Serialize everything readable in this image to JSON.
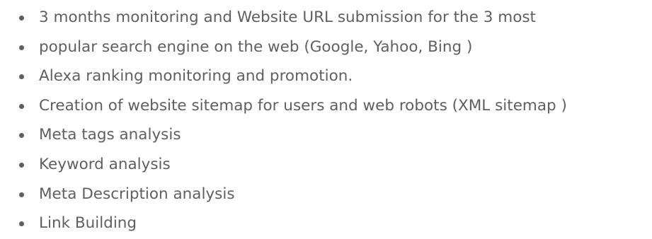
{
  "list": {
    "items": [
      "3 months monitoring and Website URL submission for the 3 most",
      "popular search engine on the web (Google, Yahoo, Bing )",
      "Alexa ranking monitoring and promotion.",
      "Creation of website sitemap for users and web robots (XML sitemap )",
      "Meta tags analysis",
      "Keyword analysis",
      "Meta Description analysis",
      "Link Building"
    ]
  },
  "colors": {
    "text": "#5f5f5f",
    "background": "#ffffff"
  }
}
